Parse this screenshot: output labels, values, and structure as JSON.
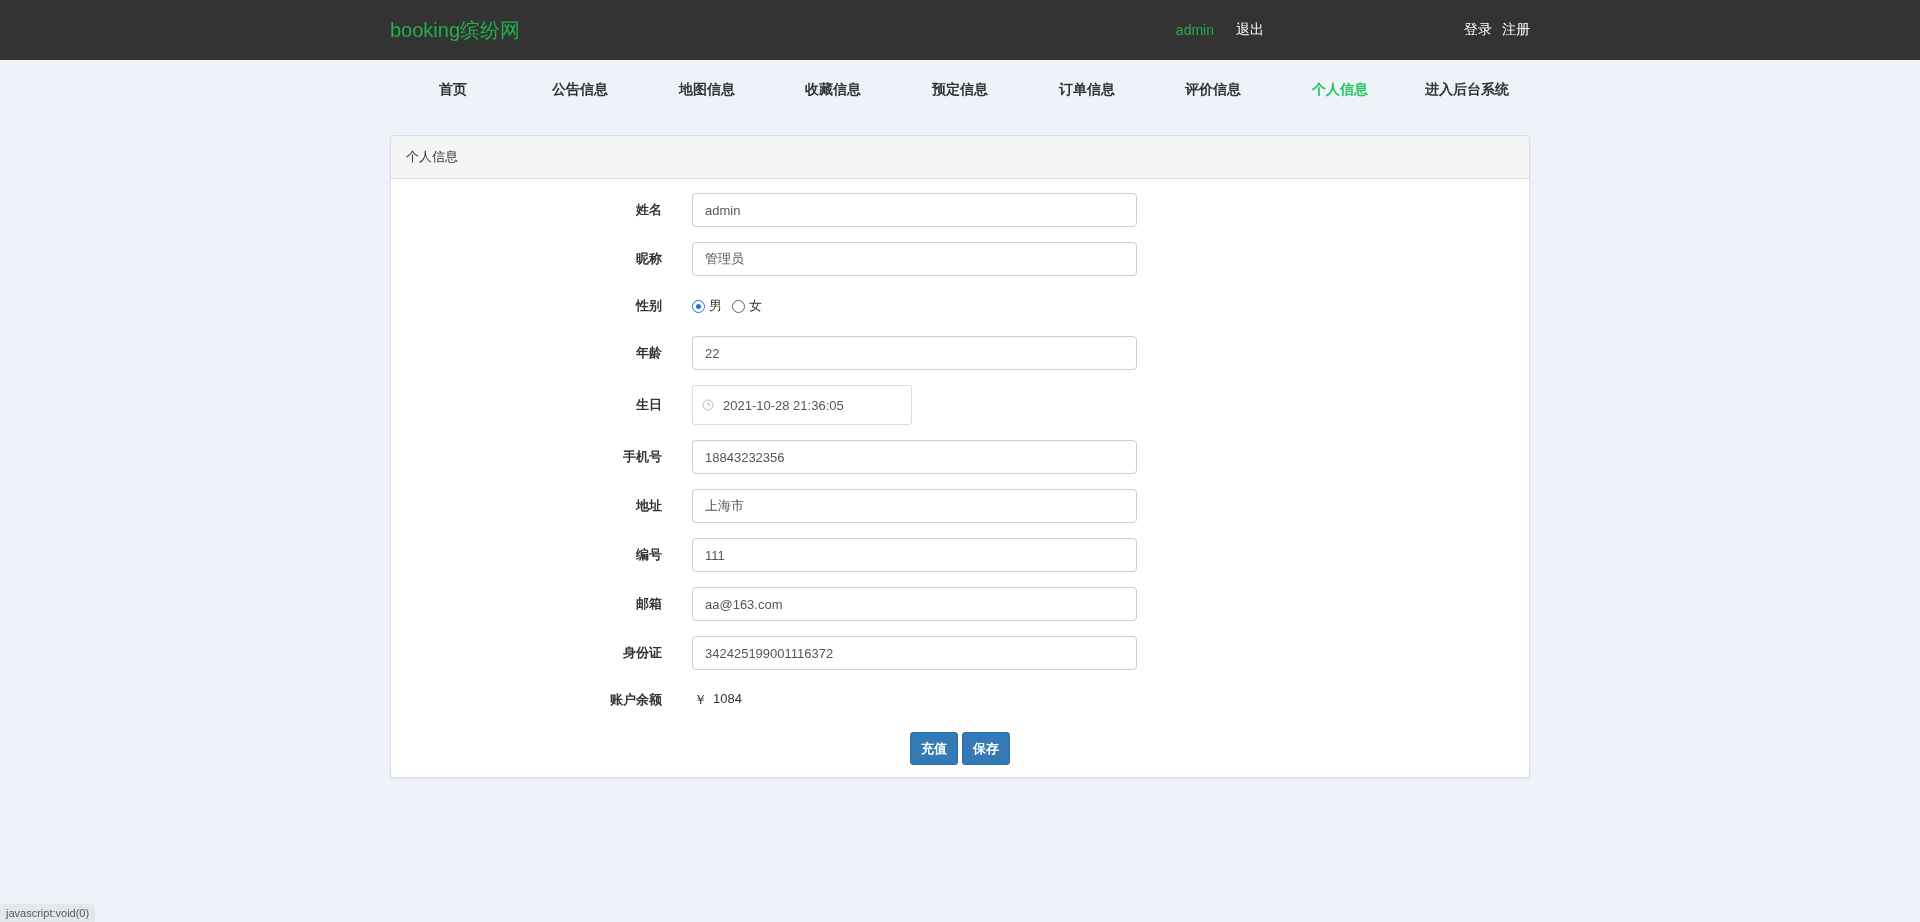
{
  "header": {
    "logo": "booking缤纷网",
    "user": "admin",
    "logout": "退出",
    "links": [
      "登录",
      "注册"
    ]
  },
  "nav": [
    {
      "label": "首页",
      "selected": false
    },
    {
      "label": "公告信息",
      "selected": false
    },
    {
      "label": "地图信息",
      "selected": false
    },
    {
      "label": "收藏信息",
      "selected": false
    },
    {
      "label": "预定信息",
      "selected": false
    },
    {
      "label": "订单信息",
      "selected": false
    },
    {
      "label": "评价信息",
      "selected": false
    },
    {
      "label": "个人信息",
      "selected": true
    },
    {
      "label": "进入后台系统",
      "selected": false
    }
  ],
  "panel": {
    "title": "个人信息",
    "fields": [
      {
        "kind": "text",
        "label": "姓名",
        "value": "admin"
      },
      {
        "kind": "text",
        "label": "昵称",
        "value": "管理员"
      },
      {
        "kind": "radio",
        "label": "性别",
        "options": [
          {
            "label": "男",
            "selected": true
          },
          {
            "label": "女",
            "selected": false
          }
        ]
      },
      {
        "kind": "text",
        "label": "年龄",
        "value": "22"
      },
      {
        "kind": "date",
        "label": "生日",
        "value": "2021-10-28 21:36:05"
      },
      {
        "kind": "text",
        "label": "手机号",
        "value": "18843232356"
      },
      {
        "kind": "text",
        "label": "地址",
        "value": "上海市"
      },
      {
        "kind": "text",
        "label": "编号",
        "value": "111"
      },
      {
        "kind": "text",
        "label": "邮箱",
        "value": "aa@163.com"
      },
      {
        "kind": "text",
        "label": "身份证",
        "value": "342425199001116372"
      },
      {
        "kind": "static",
        "label": "账户余额",
        "currency": "￥",
        "value": "1084"
      }
    ],
    "buttons": [
      "充值",
      "保存"
    ]
  },
  "status_bar": "javascript:void(0)"
}
